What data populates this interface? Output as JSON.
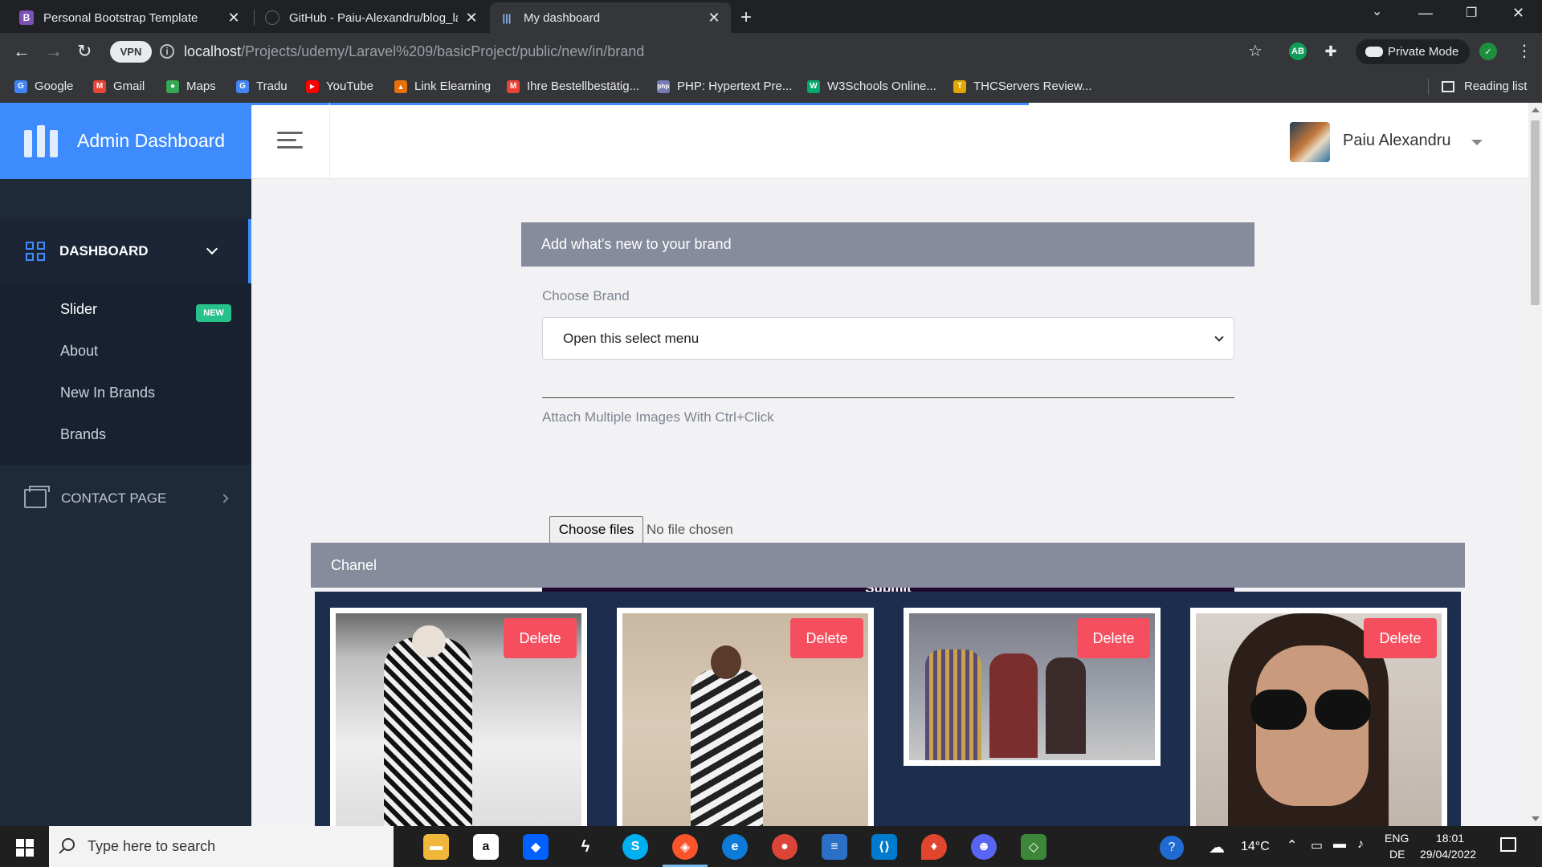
{
  "browser": {
    "tabs": [
      {
        "title": "Personal Bootstrap Template",
        "favicon": "B",
        "favicon_color": "#7952b3",
        "active": false
      },
      {
        "title": "GitHub - Paiu-Alexandru/blog_la",
        "favicon": "",
        "favicon_color": "#202124",
        "active": false
      },
      {
        "title": "My dashboard",
        "favicon": "|||",
        "favicon_color": "#3d8bfd",
        "active": true
      }
    ],
    "url_host": "localhost",
    "url_path": "/Projects/udemy/Laravel%209/basicProject/public/new/in/brand",
    "vpn_label": "VPN",
    "private_mode_label": "Private Mode",
    "extension_ab_label": "AB",
    "bookmarks": [
      {
        "label": "Google",
        "icon": "G",
        "color": "#4285f4"
      },
      {
        "label": "Gmail",
        "icon": "M",
        "color": "#ea4335"
      },
      {
        "label": "Maps",
        "icon": "●",
        "color": "#34a853"
      },
      {
        "label": "Tradu",
        "icon": "G",
        "color": "#4285f4"
      },
      {
        "label": "YouTube",
        "icon": "▶",
        "color": "#ff0000"
      },
      {
        "label": "Link Elearning",
        "icon": "▲",
        "color": "#e8710a"
      },
      {
        "label": "Ihre Bestellbestätig...",
        "icon": "M",
        "color": "#ea4335"
      },
      {
        "label": "PHP: Hypertext Pre...",
        "icon": "php",
        "color": "#777bb3"
      },
      {
        "label": "W3Schools Online...",
        "icon": "W",
        "color": "#04aa6d"
      },
      {
        "label": "THCServers Review...",
        "icon": "T",
        "color": "#e0a800"
      }
    ],
    "reading_list_label": "Reading list"
  },
  "sidebar": {
    "brand_title": "Admin Dashboard",
    "dashboard_label": "DASHBOARD",
    "submenu": [
      {
        "label": "Slider",
        "active": true
      },
      {
        "label": "About",
        "active": false
      },
      {
        "label": "New In Brands",
        "active": false,
        "badge": "NEW"
      },
      {
        "label": "Brands",
        "active": false
      }
    ],
    "contact_label": "CONTACT PAGE"
  },
  "topbar": {
    "user_name": "Paiu Alexandru"
  },
  "form": {
    "header": "Add what's new to your brand",
    "brand_label": "Choose Brand",
    "select_value": "Open this select menu",
    "images_label": "Attach Multiple Images With Ctrl+Click",
    "file_button": "Choose files",
    "file_status": "No file chosen",
    "submit_label": "Submit"
  },
  "gallery": {
    "header": "Chanel",
    "delete_label": "Delete",
    "cards": [
      {
        "name": "runway-houndstooth-look"
      },
      {
        "name": "runway-print-dress-look"
      },
      {
        "name": "runway-tweed-jackets-group"
      },
      {
        "name": "sunglasses-portrait"
      }
    ]
  },
  "taskbar": {
    "search_placeholder": "Type here to search",
    "weather": "14°C",
    "lang_top": "ENG",
    "lang_bottom": "DE",
    "time": "18:01",
    "date": "29/04/2022"
  },
  "colors": {
    "accent": "#3d8bfd",
    "sidebar_bg": "#1e2a3a",
    "card_header": "#868c9b",
    "submit_bg": "#1d0a2e",
    "delete_bg": "#f54f5f",
    "badge_bg": "#27c28c",
    "gallery_bg": "#1c2d4e"
  }
}
